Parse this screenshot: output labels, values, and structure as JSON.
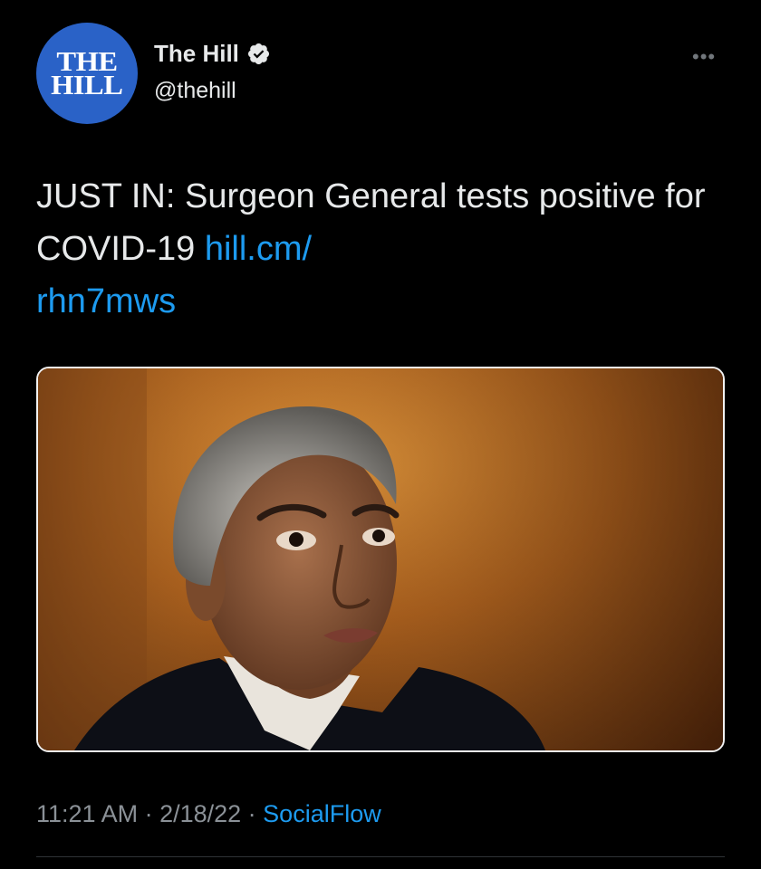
{
  "account": {
    "avatar_line1": "THE",
    "avatar_line2": "HILL",
    "display_name": "The Hill",
    "handle": "@thehill"
  },
  "tweet": {
    "text": "JUST IN: Surgeon General tests positive for COVID-19 ",
    "link_text": "hill.cm/\nrhn7mws"
  },
  "meta": {
    "time": "11:21 AM",
    "separator": " · ",
    "date": "2/18/22",
    "source": "SocialFlow"
  },
  "icons": {
    "verified": "verified-badge-icon",
    "more": "more-options-icon"
  },
  "colors": {
    "background": "#000000",
    "link": "#1d9bf0",
    "avatar": "#2a62c7",
    "muted": "#71767b"
  }
}
